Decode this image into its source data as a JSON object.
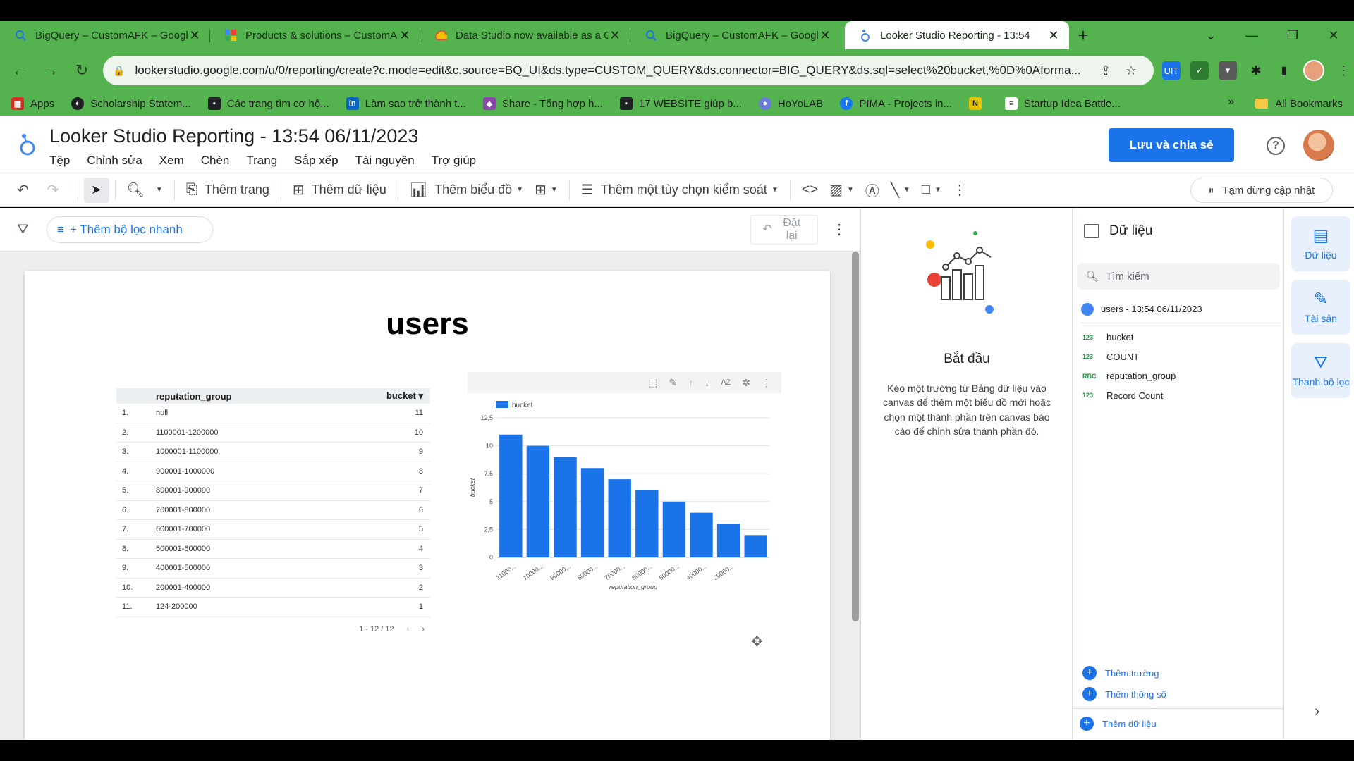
{
  "browser": {
    "tabs": [
      {
        "title": "BigQuery – CustomAFK – Googl",
        "icon": "bigquery-icon"
      },
      {
        "title": "Products & solutions – CustomA",
        "icon": "gcp-icon"
      },
      {
        "title": "Data Studio now available as a G",
        "icon": "gcloud-icon"
      },
      {
        "title": "BigQuery – CustomAFK – Googl",
        "icon": "bigquery-icon"
      },
      {
        "title": "Looker Studio Reporting - 13:54",
        "icon": "looker-icon"
      }
    ],
    "url": "lookerstudio.google.com/u/0/reporting/create?c.mode=edit&c.source=BQ_UI&ds.type=CUSTOM_QUERY&ds.connector=BIG_QUERY&ds.sql=select%20bucket,%0D%0Aforma...",
    "bookmarks": [
      {
        "label": "Apps",
        "color": "#d93025"
      },
      {
        "label": "Scholarship Statem...",
        "color": "#202124"
      },
      {
        "label": "Các trang tìm cơ hộ...",
        "color": "#202124"
      },
      {
        "label": "Làm sao trở thành t...",
        "color": "#0a66c2"
      },
      {
        "label": "Share - Tổng hợp h...",
        "color": "#8e44ad"
      },
      {
        "label": "17 WEBSITE giúp b...",
        "color": "#202124"
      },
      {
        "label": "HoYoLAB",
        "color": "#6b7bd8"
      },
      {
        "label": "PIMA - Projects in...",
        "color": "#1877f2"
      },
      {
        "label": "",
        "color": "#e5c100"
      },
      {
        "label": "Startup Idea Battle...",
        "color": "#ffffff"
      }
    ],
    "bookmarks_more": "»",
    "all_bookmarks": "All Bookmarks"
  },
  "app": {
    "title": "Looker Studio Reporting - 13:54 06/11/2023",
    "menus": [
      "Tệp",
      "Chỉnh sửa",
      "Xem",
      "Chèn",
      "Trang",
      "Sắp xếp",
      "Tài nguyên",
      "Trợ giúp"
    ],
    "share_label": "Lưu và chia sẻ",
    "help_label": "?"
  },
  "toolbar": {
    "add_page": "Thêm trang",
    "add_data": "Thêm dữ liệu",
    "add_chart": "Thêm biểu đồ",
    "add_control": "Thêm một tùy chọn kiểm soát",
    "pause_updates": "Tạm dừng cập nhật"
  },
  "filterbar": {
    "quick_filter": "+ Thêm bộ lọc nhanh",
    "reset": "Đặt lại"
  },
  "report": {
    "title": "users",
    "table": {
      "headers": {
        "group": "reputation_group",
        "value": "bucket ▾"
      },
      "rows": [
        {
          "idx": "1.",
          "group": "null",
          "value": "11"
        },
        {
          "idx": "2.",
          "group": "1100001-1200000",
          "value": "10"
        },
        {
          "idx": "3.",
          "group": "1000001-1100000",
          "value": "9"
        },
        {
          "idx": "4.",
          "group": "900001-1000000",
          "value": "8"
        },
        {
          "idx": "5.",
          "group": "800001-900000",
          "value": "7"
        },
        {
          "idx": "6.",
          "group": "700001-800000",
          "value": "6"
        },
        {
          "idx": "7.",
          "group": "600001-700000",
          "value": "5"
        },
        {
          "idx": "8.",
          "group": "500001-600000",
          "value": "4"
        },
        {
          "idx": "9.",
          "group": "400001-500000",
          "value": "3"
        },
        {
          "idx": "10.",
          "group": "200001-400000",
          "value": "2"
        },
        {
          "idx": "11.",
          "group": "124-200000",
          "value": "1"
        }
      ],
      "pagination": "1 - 12 / 12"
    }
  },
  "chart_data": {
    "type": "bar",
    "categories": [
      "11000...",
      "10000...",
      "90000...",
      "80000...",
      "70000...",
      "60000...",
      "50000...",
      "40000...",
      "20000..."
    ],
    "series": [
      {
        "name": "bucket",
        "values": [
          11,
          10,
          9,
          8,
          7,
          6,
          5,
          4,
          3,
          2
        ],
        "color": "#1a73e8"
      }
    ],
    "xlabel": "reputation_group",
    "ylabel": "bucket",
    "ylim": [
      0,
      12.5
    ],
    "yticks": [
      "0",
      "2,5",
      "5",
      "7,5",
      "10",
      "12,5"
    ],
    "legend": "top-left",
    "grid": true
  },
  "start_panel": {
    "heading": "Bắt đầu",
    "text": "Kéo một trường từ Bảng dữ liệu vào canvas để thêm một biểu đồ mới hoặc chọn một thành phần trên canvas báo cáo để chỉnh sửa thành phần đó."
  },
  "data_panel": {
    "title": "Dữ liệu",
    "search_placeholder": "Tìm kiếm",
    "source": "users - 13:54 06/11/2023",
    "fields": [
      {
        "type": "123",
        "name": "bucket"
      },
      {
        "type": "123",
        "name": "COUNT"
      },
      {
        "type": "RBC",
        "name": "reputation_group"
      },
      {
        "type": "123",
        "name": "Record Count"
      }
    ],
    "add_field": "Thêm trường",
    "add_param": "Thêm thông số",
    "add_data": "Thêm dữ liệu"
  },
  "rail": {
    "data": "Dữ liệu",
    "assets": "Tài sản",
    "filter_bar": "Thanh bộ lọc"
  }
}
